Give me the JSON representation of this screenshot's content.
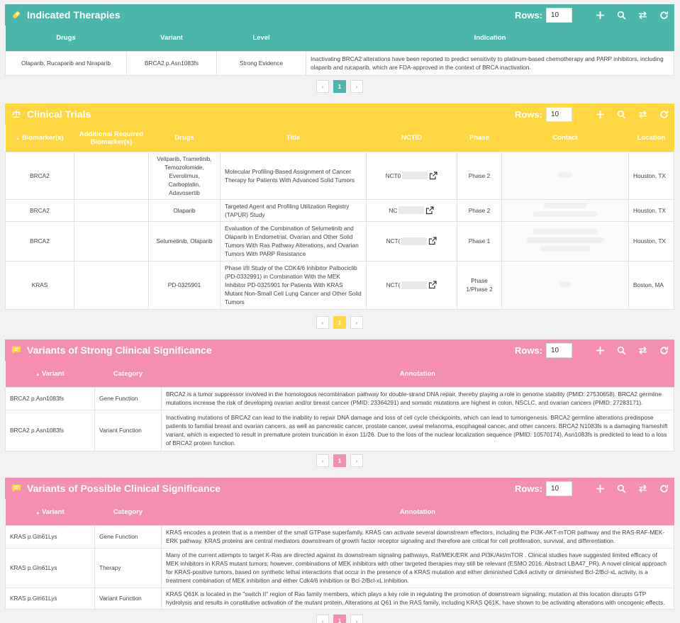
{
  "colors": {
    "teal": "#4db6ac",
    "yellow": "#ffd740",
    "pink": "#f48fb1"
  },
  "icons": {
    "search": "search-icon",
    "add": "plus-icon",
    "swap": "swap-icon",
    "refresh": "refresh-icon",
    "external": "external-link-icon"
  },
  "rows_label": "Rows:",
  "therapies": {
    "title": "Indicated Therapies",
    "rows_value": "10",
    "columns": [
      "Drugs",
      "Variant",
      "Level",
      "Indication"
    ],
    "rows": [
      {
        "drugs": "Olaparib, Rucaparib and Niraparib",
        "variant": "BRCA2 p.Asn1083fs",
        "level": "Strong Evidence",
        "indication": "Inactivating BRCA2 alterations have been reported to predict sensitivity to platinum-based chemotherapy and PARP inhibitors, including olaparib and rucaparib, which are FDA-approved in the context of BRCA inactivation."
      }
    ],
    "page": "1"
  },
  "trials": {
    "title": "Clinical Trials",
    "rows_value": "10",
    "columns": [
      "Biomarker(s)",
      "Additional Required Biomarker(s)",
      "Drugs",
      "Title",
      "NCTID",
      "Phase",
      "Contact",
      "Location"
    ],
    "rows": [
      {
        "biomarker": "BRCA2",
        "additional": "",
        "drugs": "Veliparib, Trametinib, Temozolomide, Everolimus, Carboplatin, Adavosertib",
        "title": "Molecular Profiling-Based Assignment of Cancer Therapy for Patients With Advanced Solid Tumors",
        "nctid": "NCT0",
        "phase": "Phase 2",
        "location": "Houston, TX"
      },
      {
        "biomarker": "BRCA2",
        "additional": "",
        "drugs": "Olaparib",
        "title": "Targeted Agent and Profiling Utilization Registry (TAPUR) Study",
        "nctid": "NC",
        "phase": "Phase 2",
        "location": "Houston, TX"
      },
      {
        "biomarker": "BRCA2",
        "additional": "",
        "drugs": "Selumetinib, Olaparib",
        "title": "Evaluation of the Combination of Selumetinib and Olaparib in Endometrial, Ovarian and Other Solid Tumors With Ras Pathway Alterations, and Ovarian Tumors With PARP Resistance",
        "nctid": "NCT(",
        "phase": "Phase 1",
        "location": "Houston, TX"
      },
      {
        "biomarker": "KRAS",
        "additional": "",
        "drugs": "PD-0325901",
        "title": "Phase I/II Study of the CDK4/6 Inhibitor Palbociclib (PD-0332991) in Combination With the MEK Inhibitor PD-0325901 for Patients With KRAS Mutant Non-Small Cell Lung Cancer and Other Solid Tumors",
        "nctid": "NCT(",
        "phase": "Phase 1/Phase 2",
        "location": "Boston, MA"
      }
    ],
    "page": "1"
  },
  "strong": {
    "title": "Variants of Strong Clinical Significance",
    "rows_value": "10",
    "columns": [
      "Variant",
      "Category",
      "Annotation"
    ],
    "rows": [
      {
        "variant": "BRCA2 p.Asn1083fs",
        "category": "Gene Function",
        "annotation": "BRCA2 is a tumor suppressor involved in the homologous recombination pathway for double-strand DNA repair, thereby playing a role in genome stability (PMID: 27530658). BRCA2 germline mutations increase the risk of developing ovarian and/or breast cancer (PMID: 23364291) and somatic mutations are highest in colon, NSCLC, and ovarian cancers (PMID: 27283171)."
      },
      {
        "variant": "BRCA2 p.Asn1083fs",
        "category": "Variant Function",
        "annotation": "Inactivating mutations of BRCA2 can lead to the inability to repair DNA damage and loss of cell cycle checkpoints, which can lead to tumorigenesis. BRCA2 germline alterations predispose patients to familial breast and ovarian cancers, as well as pancreatic cancer, prostate cancer, uveal melanoma, esophageal cancer, and other cancers. BRCA2 N1083fs is a damaging frameshift variant, which is expected to result in premature protein truncation in exon 11/26. Due to the loss of the nuclear localization sequence (PMID: 10570174), Asn1083fs is predicted to lead to a loss of BRCA2 protein function."
      }
    ],
    "page": "1"
  },
  "possible": {
    "title": "Variants of Possible Clinical Significance",
    "rows_value": "10",
    "columns": [
      "Variant",
      "Category",
      "Annotation"
    ],
    "rows": [
      {
        "variant": "KRAS p.Gln61Lys",
        "category": "Gene Function",
        "annotation": "KRAS encodes a protein that is a member of the small GTPase superfamily. KRAS can activate several downstream effectors, including the PI3K-AKT-mTOR pathway and the RAS-RAF-MEK-ERK pathway. KRAS proteins are central mediators downstream of growth factor receptor signaling and therefore are critical for cell proliferation, survival, and differentiation."
      },
      {
        "variant": "KRAS p.Gln61Lys",
        "category": "Therapy",
        "annotation": "Many of the current attempts to target K-Ras are directed against its downstream signaling pathways, Raf/MEK/ERK and PI3K/Akt/mTOR . Clinical studies have suggested limited efficacy of MEK inhibitors in KRAS mutant tumors; however, combinations of MEK inhibitors with other targeted therapies may still be relevant (ESMO 2016, Abstract LBA47_PR). A novel clinical approach for KRAS-positive tumors, based on synthetic lethal interactions that occur in the presence of a KRAS mutation and either diminished Cdk4 activity or diminished Bcl-2/Bcl-xL activity, is a treatment combination of MEK inhibition and either Cdk4/6 inhibition or Bcl-2/Bcl-xL inhibition."
      },
      {
        "variant": "KRAS p.Gln61Lys",
        "category": "Variant Function",
        "annotation": "KRAS Q61K is located in the \"switch II\" region of Ras family members, which plays a key role in regulating the promotion of downstream signaling; mutation at this location disrupts GTP hydrolysis and results in constitutive activation of the mutant protein. Alterations at Q61 in the RAS family, including KRAS Q61K, have shown to be activating alterations with oncogenic effects."
      }
    ],
    "page": "1"
  }
}
